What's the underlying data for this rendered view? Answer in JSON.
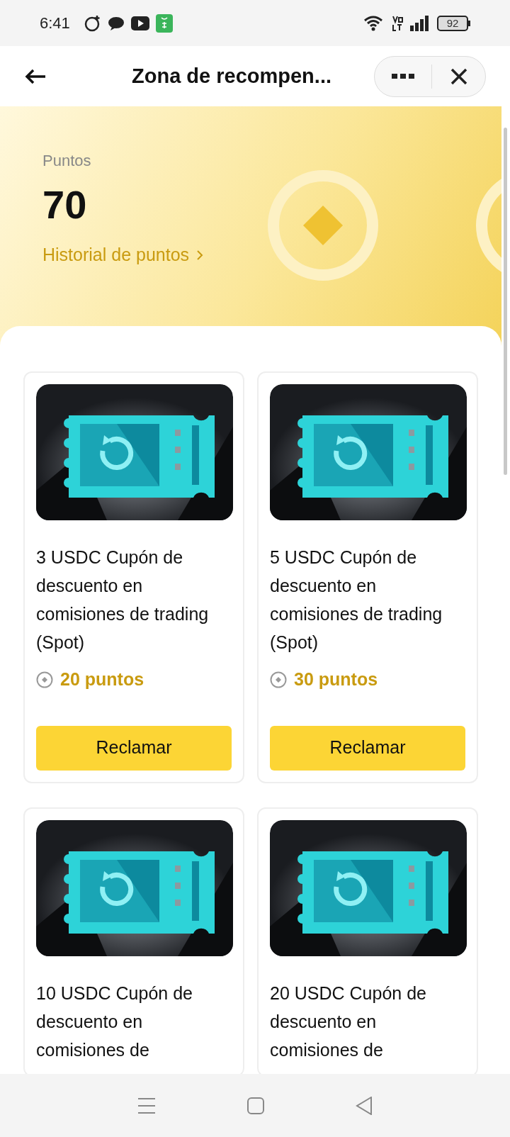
{
  "status_bar": {
    "time": "6:41",
    "battery": "92"
  },
  "header": {
    "title": "Zona de recompen..."
  },
  "points": {
    "label": "Puntos",
    "value": "70",
    "history_link": "Historial de puntos"
  },
  "rewards": [
    {
      "title": "3 USDC Cupón de descuento en comisiones de trading (Spot)",
      "cost": "20 puntos",
      "button": "Reclamar"
    },
    {
      "title": "5 USDC Cupón de descuento en comisiones de trading (Spot)",
      "cost": "30 puntos",
      "button": "Reclamar"
    },
    {
      "title": "10 USDC Cupón de descuento en comisiones de"
    },
    {
      "title": "20 USDC Cupón de descuento en comisiones de"
    }
  ]
}
